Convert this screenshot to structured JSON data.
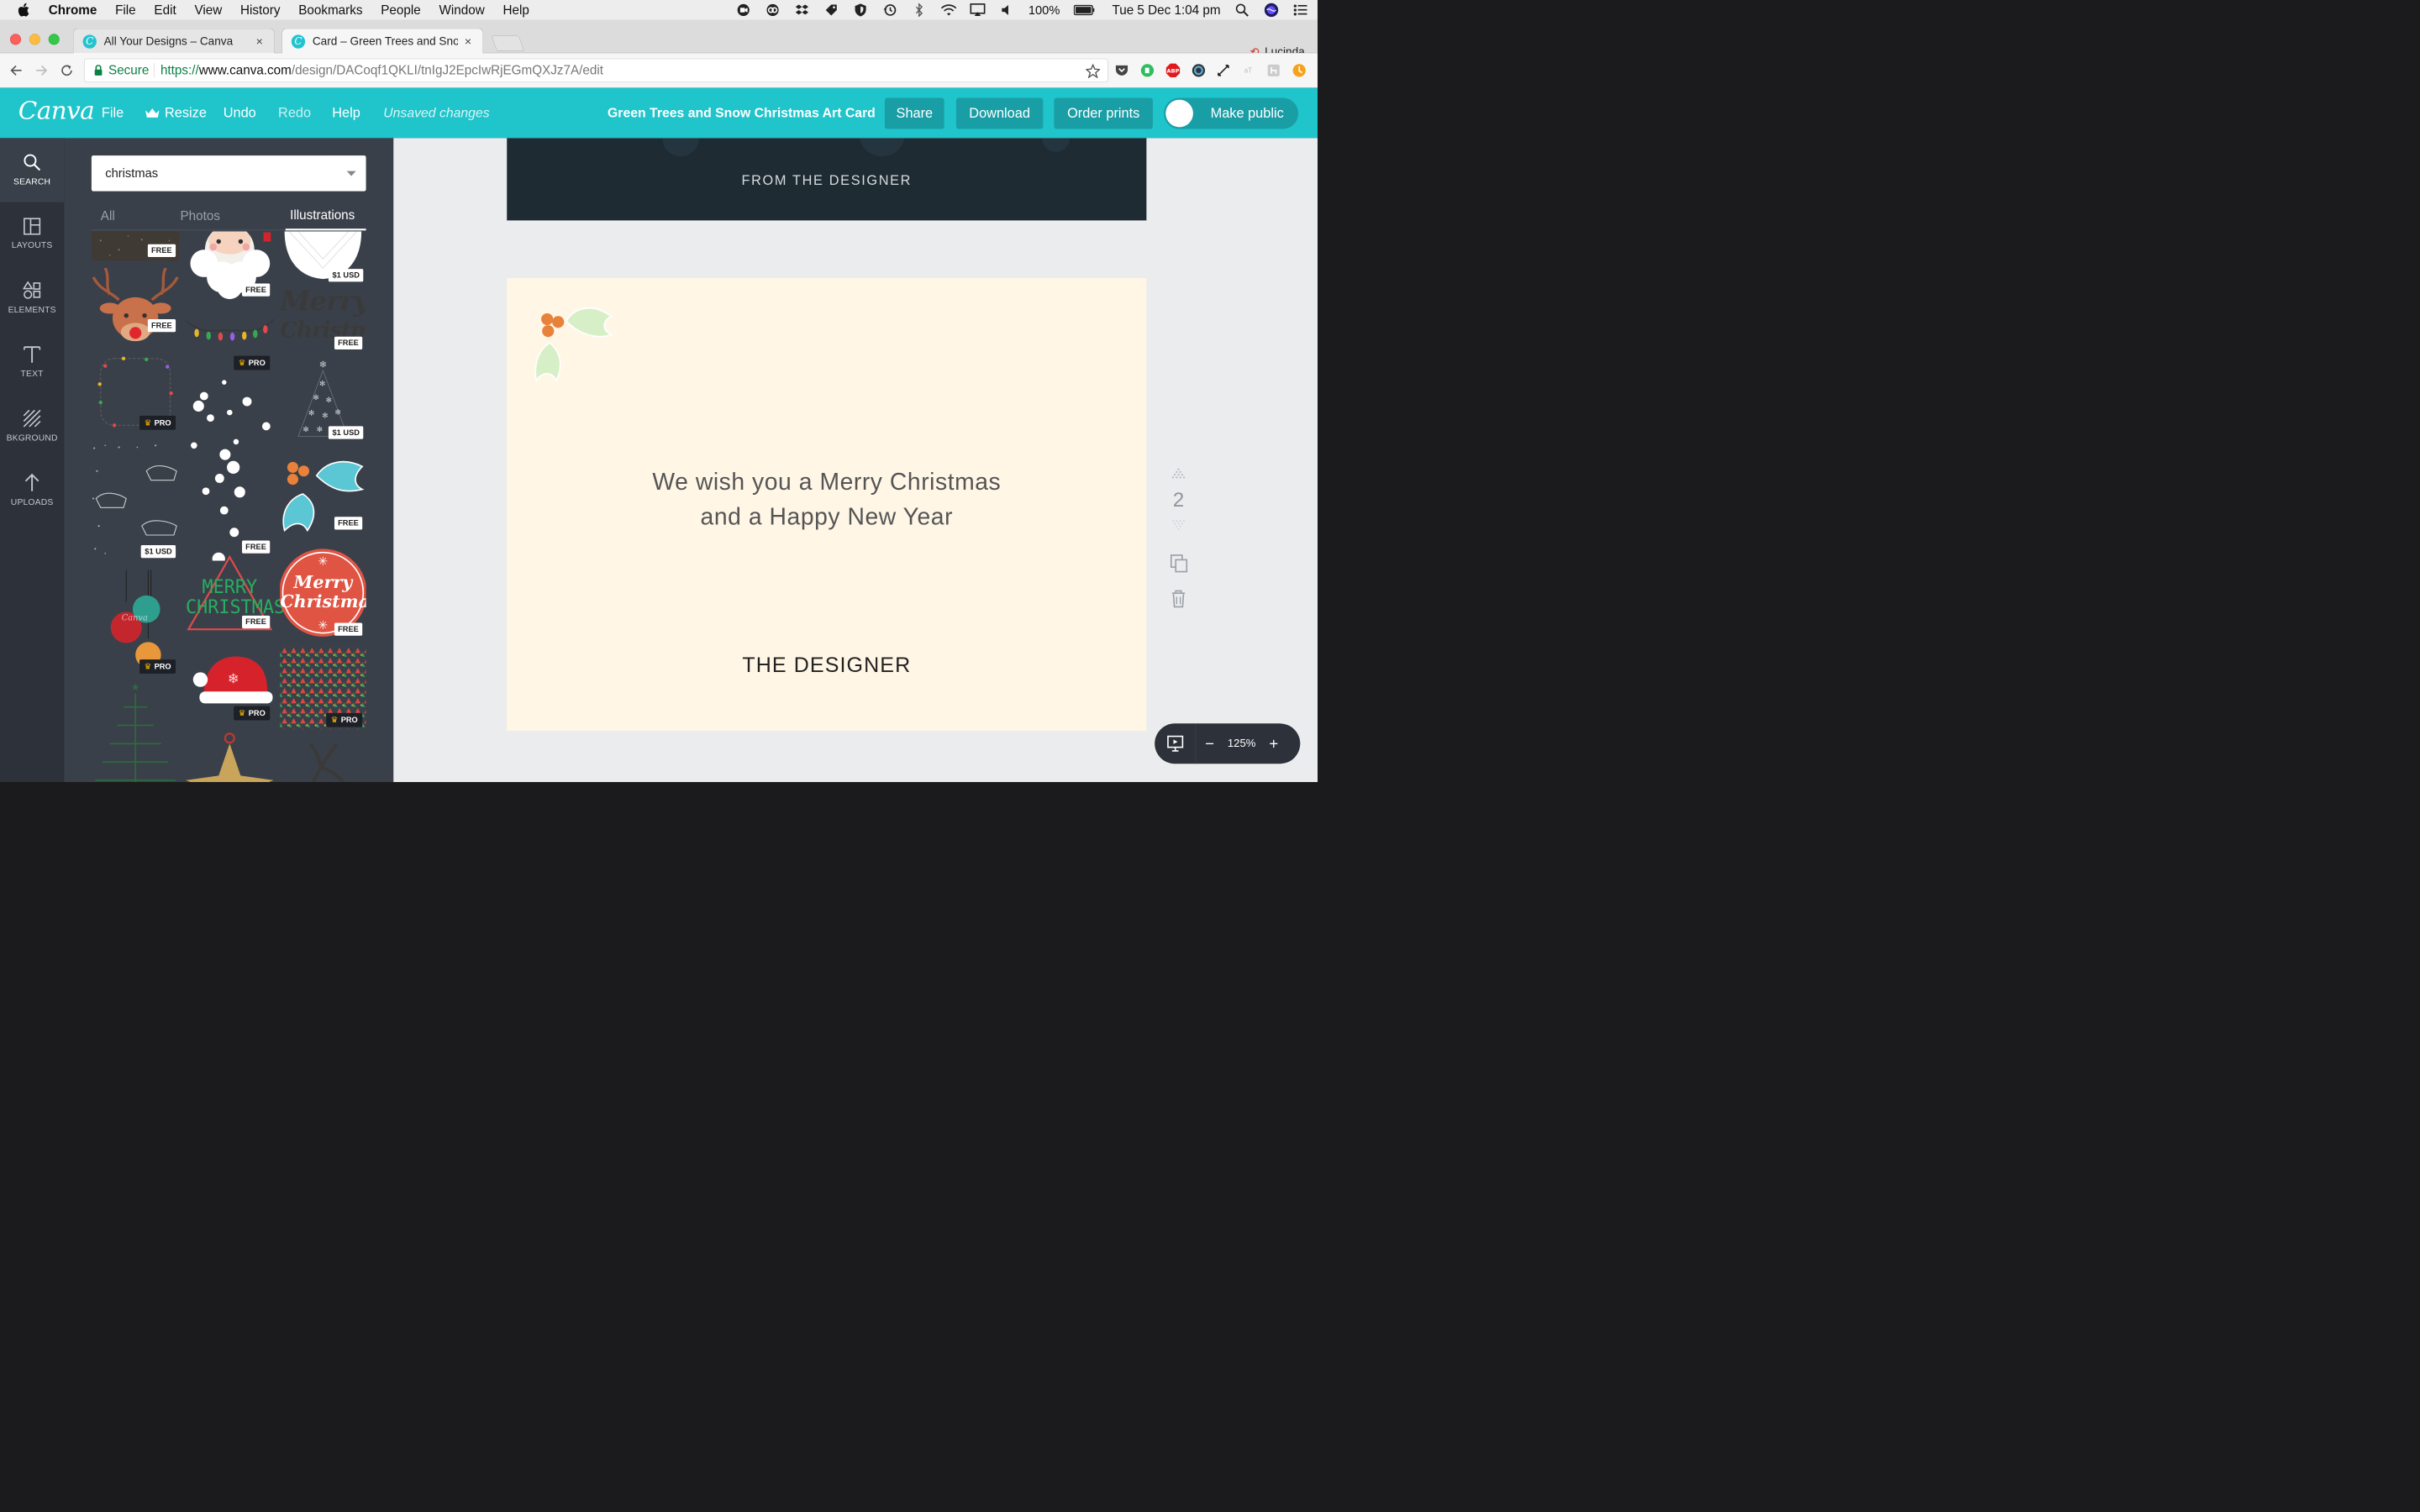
{
  "os_menubar": {
    "app": "Chrome",
    "items": [
      "File",
      "Edit",
      "View",
      "History",
      "Bookmarks",
      "People",
      "Window",
      "Help"
    ],
    "battery": "100%",
    "clock": "Tue 5 Dec  1:04 pm"
  },
  "browser": {
    "tabs": [
      {
        "title": "All Your Designs – Canva",
        "active": false
      },
      {
        "title": "Card – Green Trees and Snow C",
        "active": true
      }
    ],
    "profile": "Lucinda",
    "secure_label": "Secure",
    "url": {
      "scheme": "https://",
      "host": "www.canva.com",
      "path": "/design/DACoqf1QKLI/tnIgJ2EpcIwRjEGmQXJz7A/edit"
    }
  },
  "canva_header": {
    "logo": "Canva",
    "menu": {
      "file": "File",
      "resize": "Resize",
      "undo": "Undo",
      "redo": "Redo",
      "help": "Help"
    },
    "status": "Unsaved changes",
    "doc_title": "Green Trees and Snow Christmas Art Card",
    "share": "Share",
    "download": "Download",
    "order_prints": "Order prints",
    "make_public": "Make public"
  },
  "sidebar": {
    "items": [
      {
        "label": "SEARCH",
        "icon": "search-icon"
      },
      {
        "label": "LAYOUTS",
        "icon": "layouts-icon"
      },
      {
        "label": "ELEMENTS",
        "icon": "elements-icon"
      },
      {
        "label": "TEXT",
        "icon": "text-icon"
      },
      {
        "label": "BKGROUND",
        "icon": "background-icon"
      },
      {
        "label": "UPLOADS",
        "icon": "upload-icon"
      }
    ]
  },
  "search_panel": {
    "query": "christmas",
    "tabs": [
      "All",
      "Photos",
      "Illustrations"
    ],
    "active_tab": "Illustrations",
    "badges": {
      "free": "FREE",
      "pro": "PRO",
      "paid": "$1 USD"
    },
    "thumb_text": {
      "merry_christmas_1": "MERRY",
      "merry_christmas_2": "CHRISTMAS",
      "script_merry": "Merry",
      "script_christmas": "Christmas",
      "dark_merry": "Merry",
      "dark_christmas": "Christmas"
    }
  },
  "canvas": {
    "page1_text": "FROM THE DESIGNER",
    "greeting_line1": "We wish you a Merry Christmas",
    "greeting_line2": "and a Happy New Year",
    "signature": "THE DESIGNER",
    "page_number": "2",
    "zoom": "125%"
  }
}
